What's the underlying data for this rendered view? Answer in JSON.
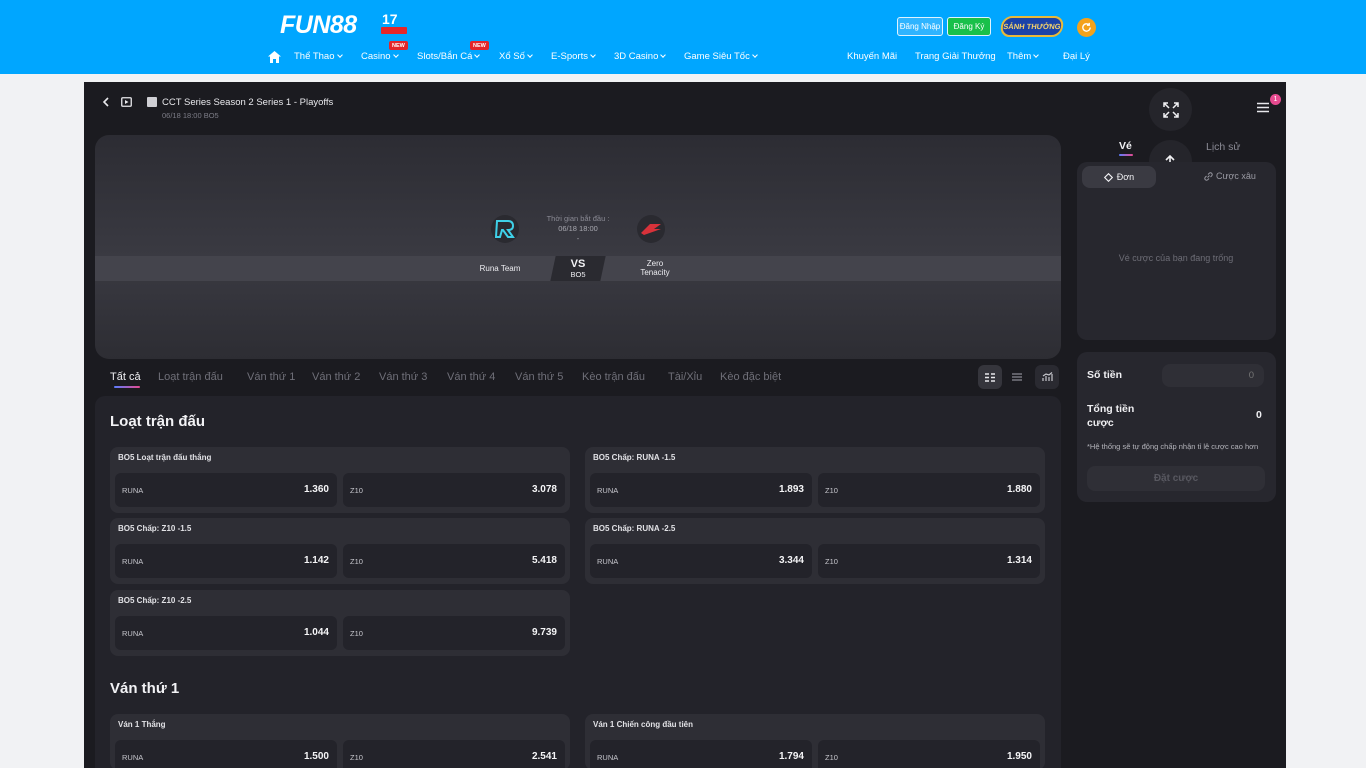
{
  "header": {
    "logo": "FUN88",
    "logo_anniv": "17",
    "login": "Đăng Nhập",
    "register": "Đăng Ký",
    "lobby_badge": "SẢNH THƯỞNG",
    "nav": [
      {
        "label": "Thể Thao"
      },
      {
        "label": "Casino",
        "badge": "NEW"
      },
      {
        "label": "Slots/Bắn Cá",
        "badge": "NEW"
      },
      {
        "label": "Xổ Số"
      },
      {
        "label": "E-Sports"
      },
      {
        "label": "3D Casino"
      },
      {
        "label": "Game Siêu Tốc"
      }
    ],
    "nav_right": [
      {
        "label": "Khuyến Mãi"
      },
      {
        "label": "Trang Giải Thưởng"
      },
      {
        "label": "Thêm"
      },
      {
        "label": "Đại Lý"
      }
    ]
  },
  "match": {
    "title": "CCT Series Season 2 Series 1 - Playoffs",
    "subtitle": "06/18 18:00 BO5",
    "start_label": "Thời gian bắt đầu :",
    "start_time": "06/18 18:00",
    "start_dot": "-",
    "team_home": "Runa Team",
    "team_away_1": "Zero",
    "team_away_2": "Tenacity",
    "vs": "VS",
    "format": "BO5",
    "menu_count": "1"
  },
  "tabs": [
    {
      "label": "Tất cả",
      "active": true
    },
    {
      "label": "Loạt trận đấu"
    },
    {
      "label": "Ván thứ 1"
    },
    {
      "label": "Ván thứ 2"
    },
    {
      "label": "Ván thứ 3"
    },
    {
      "label": "Ván thứ 4"
    },
    {
      "label": "Ván thứ 5"
    },
    {
      "label": "Kèo trận đấu"
    },
    {
      "label": "Tài/Xỉu"
    },
    {
      "label": "Kèo đặc biệt"
    }
  ],
  "sections": [
    {
      "title": "Loạt trận đấu",
      "markets": [
        {
          "title": "BO5 Loạt trận đấu thắng",
          "a": "RUNA",
          "a_odd": "1.360",
          "b": "Z10",
          "b_odd": "3.078"
        },
        {
          "title": "BO5 Chấp: RUNA -1.5",
          "a": "RUNA",
          "a_odd": "1.893",
          "b": "Z10",
          "b_odd": "1.880"
        },
        {
          "title": "BO5 Chấp: Z10 -1.5",
          "a": "RUNA",
          "a_odd": "1.142",
          "b": "Z10",
          "b_odd": "5.418"
        },
        {
          "title": "BO5 Chấp: RUNA -2.5",
          "a": "RUNA",
          "a_odd": "3.344",
          "b": "Z10",
          "b_odd": "1.314"
        },
        {
          "title": "BO5 Chấp: Z10 -2.5",
          "a": "RUNA",
          "a_odd": "1.044",
          "b": "Z10",
          "b_odd": "9.739"
        }
      ]
    },
    {
      "title": "Ván thứ 1",
      "markets": [
        {
          "title": "Ván 1 Thắng",
          "a": "RUNA",
          "a_odd": "1.500",
          "b": "Z10",
          "b_odd": "2.541"
        },
        {
          "title": "Ván 1 Chiến công đầu tiên",
          "a": "RUNA",
          "a_odd": "1.794",
          "b": "Z10",
          "b_odd": "1.950"
        }
      ]
    }
  ],
  "betslip": {
    "tab_ticket": "Vé",
    "tab_history": "Lịch sử",
    "seg_single": "Đơn",
    "seg_parlay": "Cược xâu",
    "empty": "Vé cược của bạn đang trống",
    "amount_label": "Số tiền",
    "amount_placeholder": "0",
    "total_label": "Tổng tiền cược",
    "total_value": "0",
    "note": "*Hệ thống sẽ tự động chấp nhận tỉ lệ cược cao hơn",
    "place_bet": "Đặt cược"
  },
  "colors": {
    "header_bg": "#00a6ff",
    "panel_bg": "#1b1b20",
    "accent_gradient_start": "#5a7dff",
    "accent_gradient_end": "#e64a8f"
  }
}
